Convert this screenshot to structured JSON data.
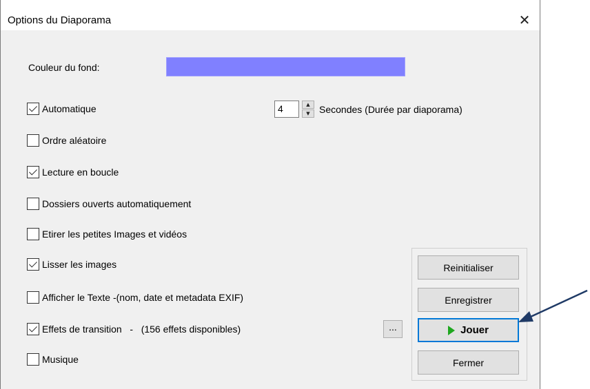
{
  "dialog": {
    "title": "Options du Diaporama",
    "close_glyph": "✕"
  },
  "background": {
    "label": "Couleur du fond:",
    "color": "#8080ff"
  },
  "duration": {
    "value": "4",
    "label": "Secondes (Durée par diaporama)"
  },
  "options": [
    {
      "label": "Automatique",
      "checked": true
    },
    {
      "label": "Ordre aléatoire",
      "checked": false
    },
    {
      "label": "Lecture en boucle",
      "checked": true
    },
    {
      "label": "Dossiers ouverts automatiquement",
      "checked": false
    },
    {
      "label": "Etirer les petites Images et vidéos",
      "checked": false
    },
    {
      "label": "Lisser les images",
      "checked": true
    },
    {
      "label": "Afficher le Texte -(nom, date et metadata EXIF)",
      "checked": false
    },
    {
      "label": "Effets de transition   -   (156 effets disponibles)",
      "checked": true
    },
    {
      "label": "Musique",
      "checked": false
    }
  ],
  "buttons": {
    "ellipsis": "...",
    "reset": "Reinitialiser",
    "save": "Enregistrer",
    "play": "Jouer",
    "close": "Fermer"
  },
  "annotation": {
    "arrow_color": "#1f3a66"
  }
}
